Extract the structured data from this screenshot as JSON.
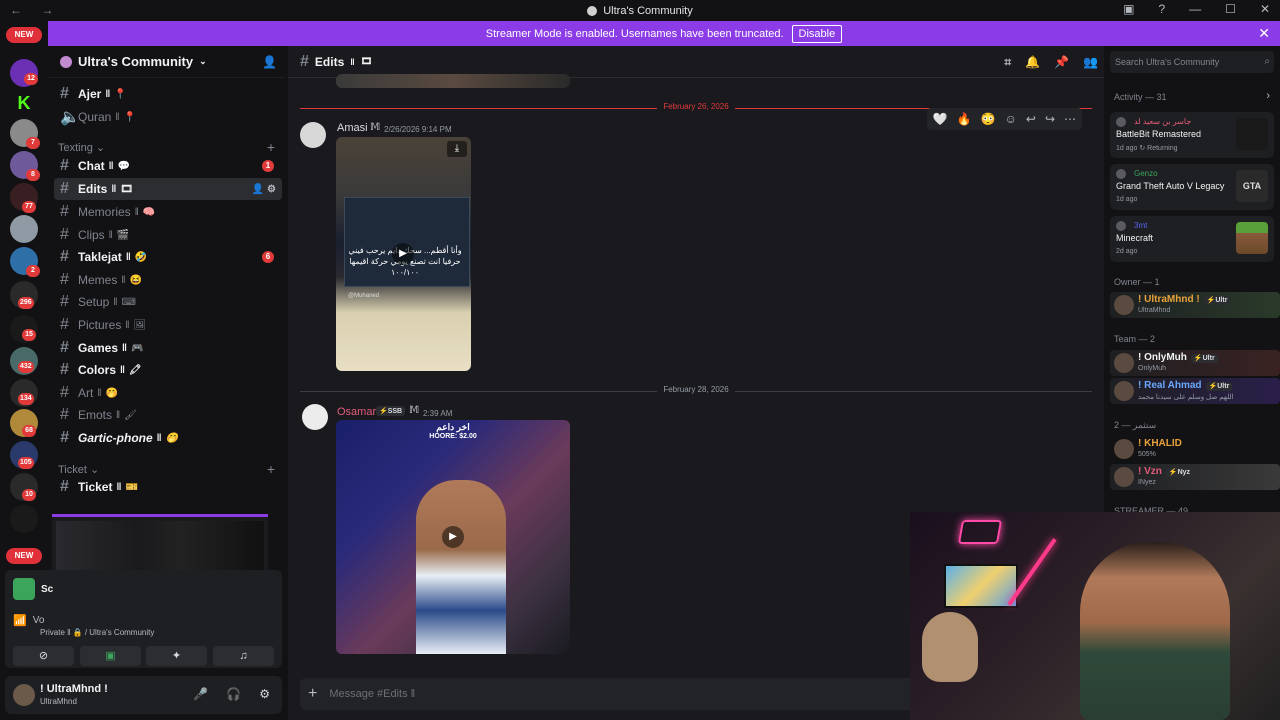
{
  "window": {
    "title": "Ultra's Community"
  },
  "banner": {
    "text": "Streamer Mode is enabled. Usernames have been truncated.",
    "button": "Disable"
  },
  "rail": {
    "new_label_top": "NEW",
    "new_label_bottom": "NEW",
    "badges": [
      "12",
      "7",
      "8",
      "77",
      "2",
      "296",
      "15",
      "432",
      "134",
      "68",
      "105",
      "10"
    ]
  },
  "server": {
    "name": "Ultra's Community"
  },
  "channels": {
    "ajer": {
      "name": "Ajer",
      "suffix": "ǁ"
    },
    "quran": {
      "name": "Quran",
      "suffix": "ǁ"
    },
    "category_texting": "Texting",
    "chat": {
      "name": "Chat",
      "suffix": "ǁ",
      "badge": "1"
    },
    "edits": {
      "name": "Edits",
      "suffix": "ǁ"
    },
    "memories": {
      "name": "Memories",
      "suffix": "ǁ"
    },
    "clips": {
      "name": "Clips",
      "suffix": "ǁ"
    },
    "taklejat": {
      "name": "Taklejat",
      "suffix": "ǁ",
      "badge": "6"
    },
    "memes": {
      "name": "Memes",
      "suffix": "ǁ"
    },
    "setup": {
      "name": "Setup",
      "suffix": "ǁ"
    },
    "pictures": {
      "name": "Pictures",
      "suffix": "ǁ"
    },
    "games": {
      "name": "Games",
      "suffix": "ǁ"
    },
    "colors": {
      "name": "Colors",
      "suffix": "ǁ"
    },
    "art": {
      "name": "Art",
      "suffix": "ǁ"
    },
    "emots": {
      "name": "Emots",
      "suffix": "ǁ"
    },
    "gartic": {
      "name": "Gartic-phone",
      "suffix": "ǁ"
    },
    "category_ticket": "Ticket",
    "ticket": {
      "name": "Ticket",
      "suffix": "ǁ"
    }
  },
  "voice": {
    "private_text": "Private ǁ 🔒 / Ultra's Community",
    "sc_label": "Sc",
    "vo_label": "Vo"
  },
  "user": {
    "name": "! UltraMhnd !",
    "status": "UltraMhnd"
  },
  "chat": {
    "channel": "Edits",
    "channel_suffix": "ǁ",
    "date1": "February 26, 2026",
    "date2": "February 28, 2026",
    "msg1": {
      "author": "Amasi",
      "time": "2/26/2026 9:14 PM",
      "author_color": "#dbdee1"
    },
    "msg2": {
      "author": "Osamar",
      "tag": "SSB",
      "time": "2:39 AM",
      "author_color": "#e35b7a"
    },
    "video1_caption": "وأنا أقطم... سحك دايم يرحب فيني حرفيا انت تصنع يومي حركة اقيمها ١٠٠/١٠٠",
    "video1_handle": "@Muhaned",
    "video2_caption_line1": "اخر داعم",
    "video2_caption_line2": "HOORE: $2.00",
    "composer_placeholder": "Message #Edits ǁ"
  },
  "members": {
    "search_placeholder": "Search Ultra's Community",
    "activity_header": "Activity — 31",
    "activities": [
      {
        "user": "جاسر بن سعيد لد",
        "game": "BattleBit Remastered",
        "meta": "1d ago  ↻ Returning",
        "user_color": "#e35b7a"
      },
      {
        "user": "Genzo",
        "game": "Grand Theft Auto V Legacy",
        "meta": "1d ago",
        "user_color": "#3ba55c"
      },
      {
        "user": "3mt",
        "game": "Minecraft",
        "meta": "2d ago",
        "user_color": "#5865f2"
      }
    ],
    "owner_header": "Owner — 1",
    "owner": {
      "name": "! UltraMhnd !",
      "tag": "Ultr",
      "sub": "UltraMhnd",
      "color": "#e8a33a"
    },
    "team_header": "Team — 2",
    "team": [
      {
        "name": "! OnlyMuh",
        "tag": "Ultr",
        "sub": "OnlyMuh",
        "color": "#f2f3f5"
      },
      {
        "name": "! Real Ahmad",
        "tag": "Ultr",
        "sub": "اللهم صل وسلم على سيدنا محمد",
        "color": "#6aa8ff"
      }
    ],
    "streamer_header": "ستثمر — 2",
    "streamers": [
      {
        "name": "! KHALID",
        "sub": "505%",
        "color": "#e8a33a"
      },
      {
        "name": "! Vzn",
        "tag": "Nyz",
        "sub": "INyez",
        "color": "#e35b7a"
      }
    ],
    "more_header": "STREAMER — 49"
  },
  "colors": {
    "accent": "#8b3ce6",
    "danger": "#e03a3a"
  }
}
